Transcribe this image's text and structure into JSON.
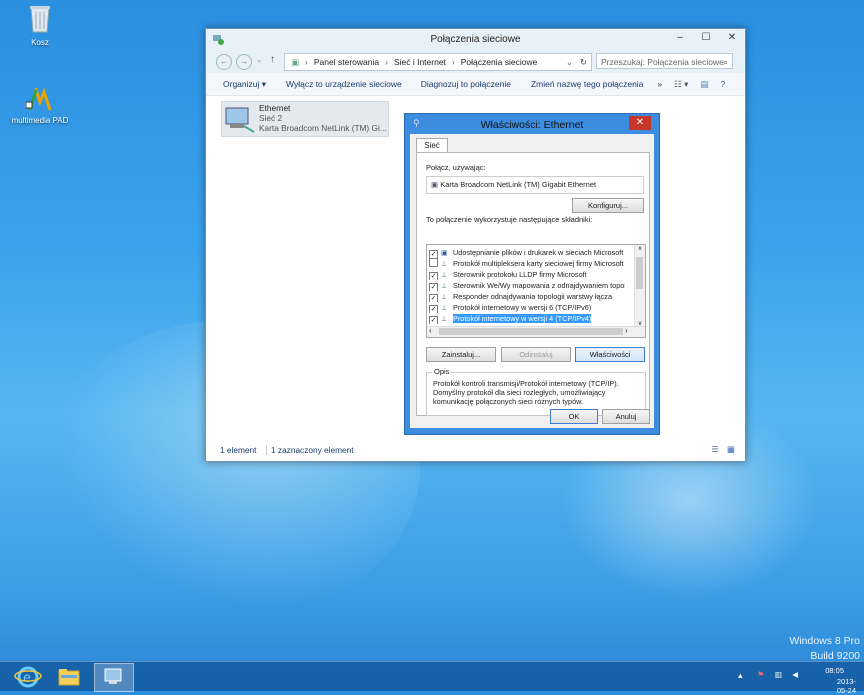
{
  "desktop": {
    "icons": [
      {
        "label": "Kosz",
        "icon": "recycle-bin-icon"
      },
      {
        "label": "multimedia PAD",
        "icon": "multimedia-pad-icon"
      }
    ],
    "watermark_line1": "Windows 8 Pro",
    "watermark_line2": "Build 9200"
  },
  "explorer": {
    "title": "Połączenia sieciowe",
    "breadcrumb": [
      "Panel sterowania",
      "Sieć i Internet",
      "Połączenia sieciowe"
    ],
    "search_placeholder": "Przeszukaj: Połączenia sieciowe",
    "toolbar": {
      "organize": "Organizuj ▾",
      "disable": "Wyłącz to urządzenie sieciowe",
      "diagnose": "Diagnozuj to połączenie",
      "rename": "Zmień nazwę tego połączenia",
      "more": "»"
    },
    "item": {
      "name": "Ethernet",
      "network": "Sieć  2",
      "adapter": "Karta Broadcom NetLink (TM) Gi..."
    },
    "status": {
      "count": "1 element",
      "selected": "1 zaznaczony element"
    }
  },
  "dialog": {
    "title": "Właściwości: Ethernet",
    "tab": "Sieć",
    "connect_using_label": "Połącz, używając:",
    "adapter": "Karta Broadcom NetLink (TM) Gigabit Ethernet",
    "configure_button": "Konfiguruj...",
    "components_label": "To połączenie wykorzystuje następujące składniki:",
    "components": [
      {
        "label": "Udostępnianie plików i drukarek w sieciach Microsoft N",
        "checked": true,
        "selected": false
      },
      {
        "label": "Protokół multipleksera karty sieciowej firmy Microsoft",
        "checked": false,
        "selected": false
      },
      {
        "label": "Sterownik protokołu LLDP firmy Microsoft",
        "checked": true,
        "selected": false
      },
      {
        "label": "Sterownik We/Wy mapowania z odnajdywaniem topolo",
        "checked": true,
        "selected": false
      },
      {
        "label": "Responder odnajdywania topologii warstwy łącza",
        "checked": true,
        "selected": false
      },
      {
        "label": "Protokół internetowy w wersji 6 (TCP/IPv6)",
        "checked": true,
        "selected": false
      },
      {
        "label": "Protokół internetowy w wersji 4 (TCP/IPv4)",
        "checked": true,
        "selected": true
      }
    ],
    "install_button": "Zainstaluj...",
    "uninstall_button": "Odinstaluj",
    "properties_button": "Właściwości",
    "description_title": "Opis",
    "description": "Protokół kontroli transmisji/Protokół internetowy (TCP/IP). Domyślny protokół dla sieci rozległych, umożliwiający komunikację połączonych sieci różnych typów.",
    "ok_button": "OK",
    "cancel_button": "Anuluj"
  },
  "taskbar": {
    "time": "08:05",
    "date": "2013-05-24"
  }
}
